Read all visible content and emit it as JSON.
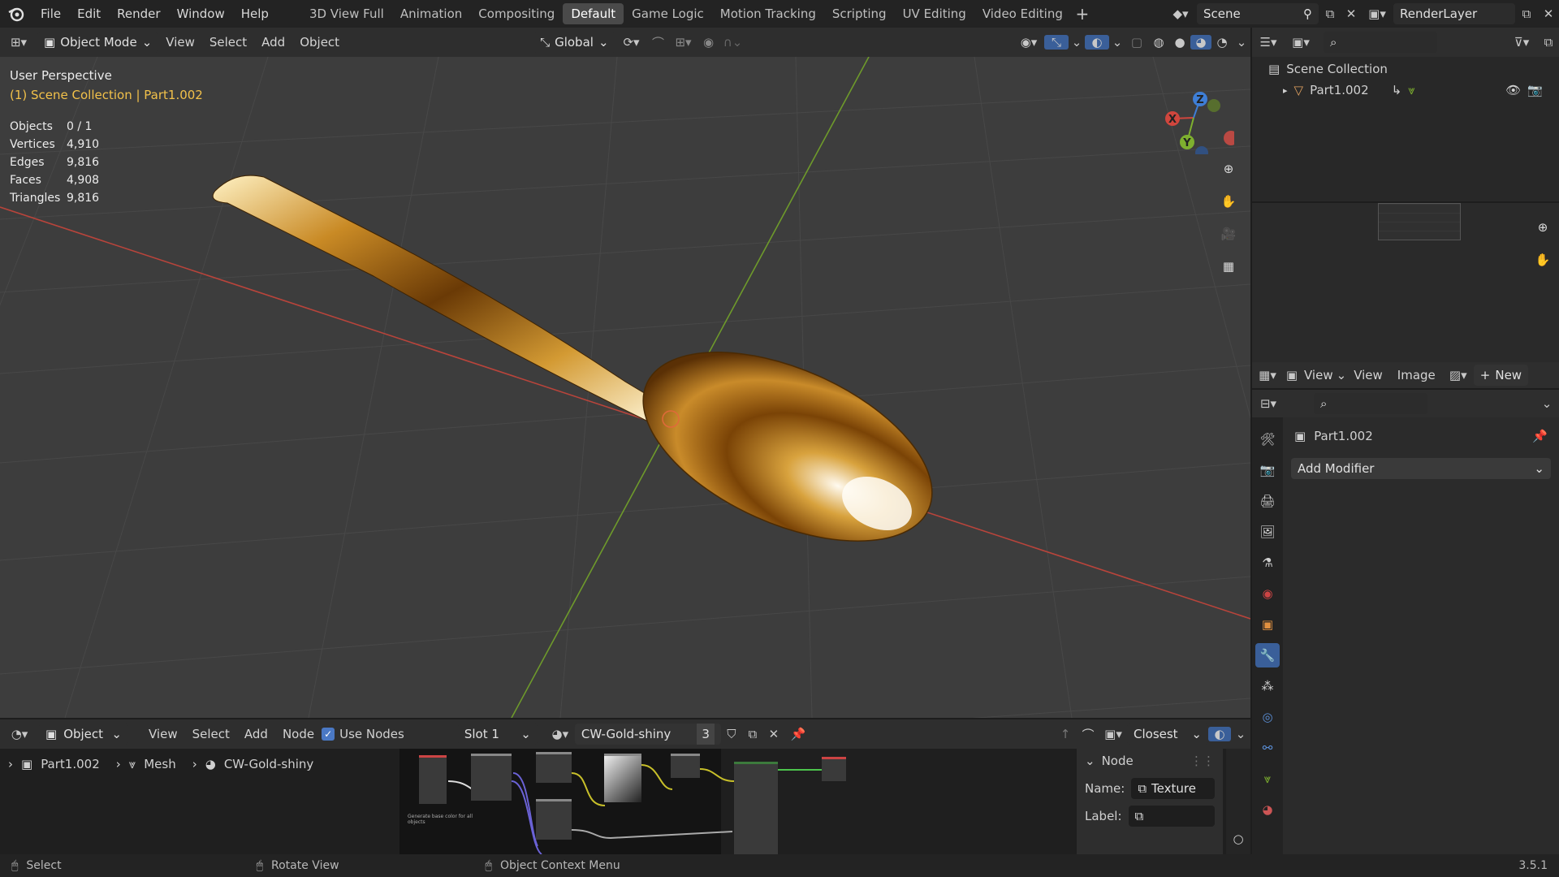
{
  "app": {
    "version": "3.5.1"
  },
  "menu": [
    "File",
    "Edit",
    "Render",
    "Window",
    "Help"
  ],
  "workspaces": [
    {
      "label": "3D View Full",
      "active": false
    },
    {
      "label": "Animation",
      "active": false
    },
    {
      "label": "Compositing",
      "active": false
    },
    {
      "label": "Default",
      "active": true
    },
    {
      "label": "Game Logic",
      "active": false
    },
    {
      "label": "Motion Tracking",
      "active": false
    },
    {
      "label": "Scripting",
      "active": false
    },
    {
      "label": "UV Editing",
      "active": false
    },
    {
      "label": "Video Editing",
      "active": false
    }
  ],
  "scene": {
    "name": "Scene",
    "render_layer": "RenderLayer"
  },
  "viewport_header": {
    "mode": "Object Mode",
    "view": "View",
    "select": "Select",
    "add": "Add",
    "object": "Object",
    "orientation": "Global"
  },
  "viewport": {
    "perspective": "User Perspective",
    "collection_line": "(1) Scene Collection | Part1.002",
    "stats": [
      {
        "label": "Objects",
        "value": "0 / 1"
      },
      {
        "label": "Vertices",
        "value": "4,910"
      },
      {
        "label": "Edges",
        "value": "9,816"
      },
      {
        "label": "Faces",
        "value": "4,908"
      },
      {
        "label": "Triangles",
        "value": "9,816"
      }
    ],
    "axis_colors": {
      "x": "#d0463d",
      "y": "#7eb02f",
      "z": "#3e7ed6"
    },
    "gizmo": {
      "x": "X",
      "y": "Y",
      "z": "Z"
    }
  },
  "outliner": {
    "root": "Scene Collection",
    "items": [
      {
        "label": "Part1.002"
      }
    ]
  },
  "image_editor": {
    "view1": "View",
    "view2": "View",
    "image": "Image",
    "new": "New"
  },
  "properties": {
    "object": "Part1.002",
    "add_modifier": "Add Modifier"
  },
  "node_header": {
    "editor": "Object",
    "view": "View",
    "select": "Select",
    "add": "Add",
    "node": "Node",
    "use_nodes": "Use Nodes",
    "slot": "Slot 1",
    "material": "CW-Gold-shiny",
    "users": "3",
    "interp": "Closest"
  },
  "breadcrumb": [
    "Part1.002",
    "Mesh",
    "CW-Gold-shiny"
  ],
  "node_panel": {
    "title": "Node",
    "name_label": "Name:",
    "name_value": "Texture ...",
    "label_label": "Label:"
  },
  "node_note": "Generate base color for all objects",
  "status": {
    "select": "Select",
    "rotate": "Rotate View",
    "context": "Object Context Menu"
  }
}
